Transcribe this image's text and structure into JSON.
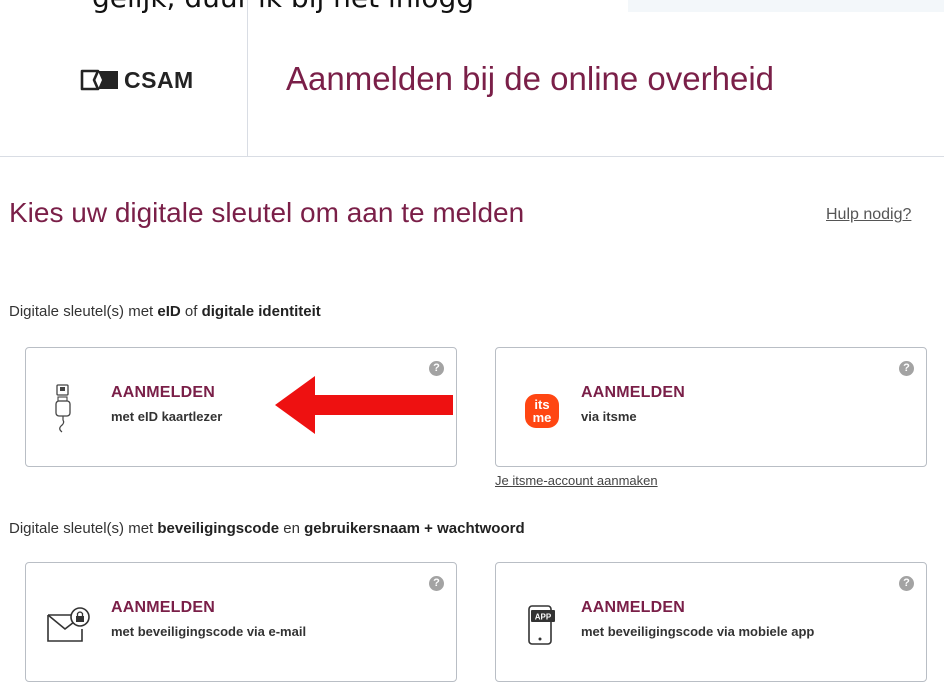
{
  "top_fragment": "gelijk, duur ik bij het inlogg",
  "header": {
    "logo_text": "CSAM",
    "logo_color": "#232323",
    "title": "Aanmelden bij de online overheid"
  },
  "main": {
    "heading": "Kies uw digitale sleutel om aan te melden",
    "help_link": "Hulp nodig?",
    "sections": [
      {
        "label_parts": [
          "Digitale sleutel(s) met ",
          "eID",
          " of ",
          "digitale identiteit"
        ],
        "cards": [
          {
            "title": "AANMELDEN",
            "subtitle": "met eID kaartlezer",
            "icon": "card-reader-icon",
            "help": "?"
          },
          {
            "title": "AANMELDEN",
            "subtitle": "via itsme",
            "icon": "itsme-logo",
            "help": "?",
            "link": "Je itsme-account aanmaken",
            "logo_text_top": "its",
            "logo_text_bottom": "me"
          }
        ]
      },
      {
        "label_parts": [
          "Digitale sleutel(s) met ",
          "beveiligingscode",
          " en ",
          "gebruikersnaam + wachtwoord"
        ],
        "cards": [
          {
            "title": "AANMELDEN",
            "subtitle": "met beveiligingscode via e-mail",
            "icon": "envelope-lock-icon",
            "help": "?"
          },
          {
            "title": "AANMELDEN",
            "subtitle": "met beveiligingscode via mobiele app",
            "icon": "phone-app-icon",
            "help": "?",
            "icon_label": "APP"
          }
        ]
      }
    ]
  },
  "colors": {
    "brand": "#7a1f48",
    "itsme_orange": "#ff4612",
    "annotation_arrow": "#ee1111",
    "border": "#b9bec5"
  },
  "annotation": {
    "type": "red-arrow",
    "points_to": "eID kaartlezer"
  }
}
